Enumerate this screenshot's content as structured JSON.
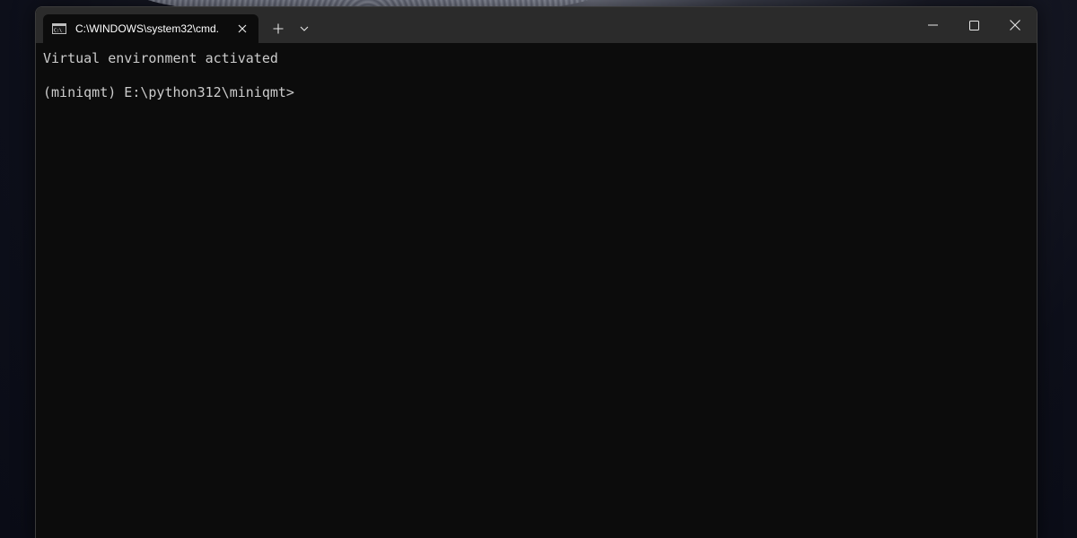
{
  "window": {
    "tab": {
      "title": "C:\\WINDOWS\\system32\\cmd.",
      "icon": "cmd-icon"
    },
    "new_tab_icon": "plus-icon",
    "dropdown_icon": "chevron-down-icon",
    "caption_buttons": {
      "minimize_icon": "minimize-icon",
      "maximize_icon": "maximize-icon",
      "close_icon": "close-icon"
    }
  },
  "terminal": {
    "lines": [
      "Virtual environment activated",
      "",
      "(miniqmt) E:\\python312\\miniqmt>"
    ]
  },
  "colors": {
    "terminal_bg": "#0c0c0c",
    "titlebar_bg": "#2b2b2b",
    "text": "#cccccc"
  }
}
